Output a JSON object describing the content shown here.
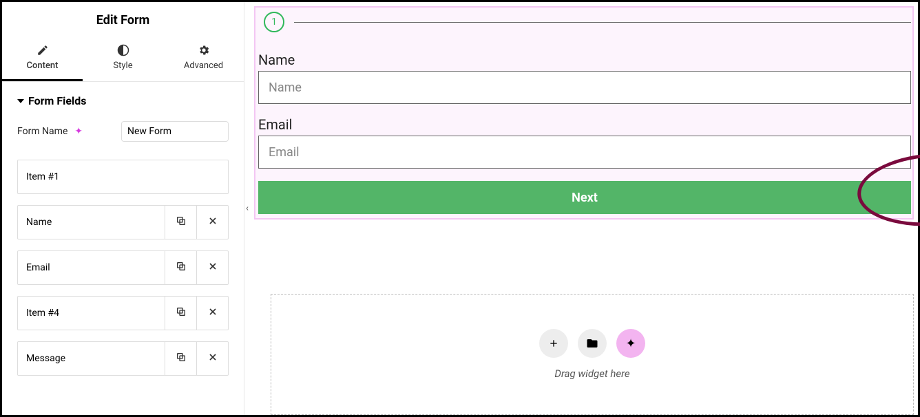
{
  "panelTitle": "Edit Form",
  "tabs": {
    "content": "Content",
    "style": "Style",
    "advanced": "Advanced"
  },
  "sectionTitle": "Form Fields",
  "formNameLabel": "Form Name",
  "formNameValue": "New Form",
  "fields": [
    {
      "label": "Item #1",
      "showActions": false
    },
    {
      "label": "Name",
      "showActions": true
    },
    {
      "label": "Email",
      "showActions": true
    },
    {
      "label": "Item #4",
      "showActions": true
    },
    {
      "label": "Message",
      "showActions": true
    }
  ],
  "preview": {
    "stepNumber": "1",
    "nameLabel": "Name",
    "namePlaceholder": "Name",
    "emailLabel": "Email",
    "emailPlaceholder": "Email",
    "nextLabel": "Next"
  },
  "dropZone": {
    "label": "Drag widget here"
  }
}
